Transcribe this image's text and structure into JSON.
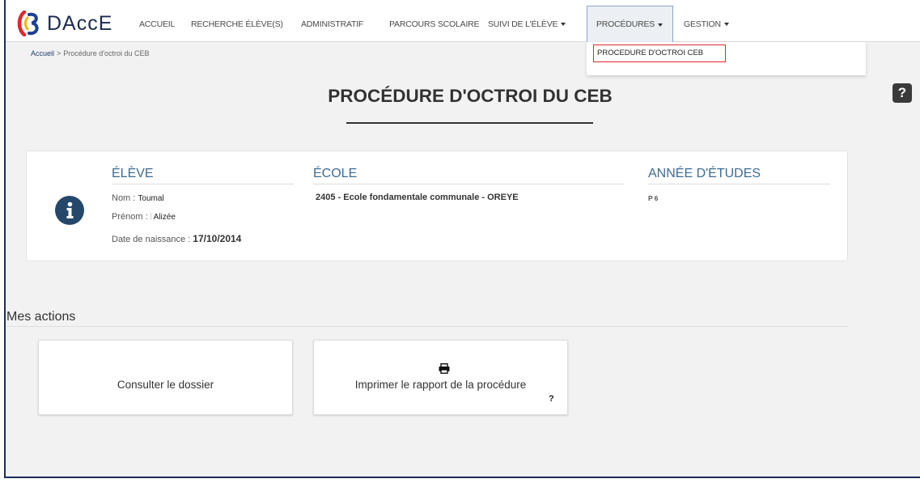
{
  "app": {
    "logo_icon": "daccE-logo-icon",
    "name": "DAccE",
    "colors": {
      "brand_navy": "#1c2a4f",
      "heading_blue": "#3e6b93",
      "highlight_red": "#e0282e",
      "frame": "#1c2d5a"
    }
  },
  "nav": {
    "items": [
      {
        "label": "ACCUEIL",
        "dropdown": false
      },
      {
        "label": "RECHERCHE ÉLÈVE(S)",
        "dropdown": false
      },
      {
        "label": "ADMINISTRATIF",
        "dropdown": false
      },
      {
        "label": "PARCOURS SCOLAIRE",
        "dropdown": false
      },
      {
        "label": "SUIVI DE L'ÉLÈVE",
        "dropdown": true
      },
      {
        "label": "PROCÉDURES",
        "dropdown": true,
        "active": true
      },
      {
        "label": "GESTION",
        "dropdown": true
      }
    ],
    "caret_icon": "caret-down-icon"
  },
  "dropdown_menu": {
    "items": [
      {
        "label": "PROCEDURE D'OCTROI CEB",
        "highlighted": true
      }
    ]
  },
  "breadcrumb": {
    "items": [
      "Accueil",
      "Procédure d'octroi du CEB"
    ],
    "separator": ">"
  },
  "page": {
    "title": "PROCÉDURE D'OCTROI DU CEB"
  },
  "help": {
    "icon": "question-icon",
    "glyph": "?"
  },
  "student_card": {
    "icon": "info-icon",
    "eleve": {
      "heading": "ÉLÈVE",
      "nom_label": "Nom :",
      "nom": "Toumal",
      "prenom_label": "Prénom :",
      "prenom": "Alizée",
      "naissance_label": "Date de naissance :",
      "naissance": "17/10/2014"
    },
    "ecole": {
      "heading": "ÉCOLE",
      "value": "2405 - Ecole fondamentale communale - OREYE"
    },
    "annee": {
      "heading": "ANNÉE D'ÉTUDES",
      "value": "P6"
    }
  },
  "actions": {
    "heading": "Mes actions",
    "items": [
      {
        "label": "Consulter le dossier"
      },
      {
        "label": "Imprimer le rapport de la procédure",
        "icon": "printer-icon",
        "help_glyph": "?"
      }
    ]
  }
}
